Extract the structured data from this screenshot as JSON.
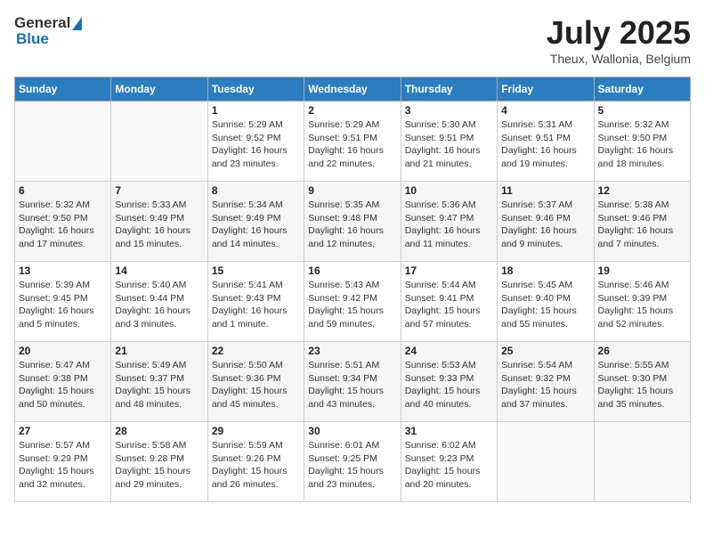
{
  "header": {
    "logo_general": "General",
    "logo_blue": "Blue",
    "month_year": "July 2025",
    "location": "Theux, Wallonia, Belgium"
  },
  "calendar": {
    "days_of_week": [
      "Sunday",
      "Monday",
      "Tuesday",
      "Wednesday",
      "Thursday",
      "Friday",
      "Saturday"
    ],
    "weeks": [
      [
        {
          "day": "",
          "sunrise": "",
          "sunset": "",
          "daylight": ""
        },
        {
          "day": "",
          "sunrise": "",
          "sunset": "",
          "daylight": ""
        },
        {
          "day": "1",
          "sunrise": "Sunrise: 5:29 AM",
          "sunset": "Sunset: 9:52 PM",
          "daylight": "Daylight: 16 hours and 23 minutes."
        },
        {
          "day": "2",
          "sunrise": "Sunrise: 5:29 AM",
          "sunset": "Sunset: 9:51 PM",
          "daylight": "Daylight: 16 hours and 22 minutes."
        },
        {
          "day": "3",
          "sunrise": "Sunrise: 5:30 AM",
          "sunset": "Sunset: 9:51 PM",
          "daylight": "Daylight: 16 hours and 21 minutes."
        },
        {
          "day": "4",
          "sunrise": "Sunrise: 5:31 AM",
          "sunset": "Sunset: 9:51 PM",
          "daylight": "Daylight: 16 hours and 19 minutes."
        },
        {
          "day": "5",
          "sunrise": "Sunrise: 5:32 AM",
          "sunset": "Sunset: 9:50 PM",
          "daylight": "Daylight: 16 hours and 18 minutes."
        }
      ],
      [
        {
          "day": "6",
          "sunrise": "Sunrise: 5:32 AM",
          "sunset": "Sunset: 9:50 PM",
          "daylight": "Daylight: 16 hours and 17 minutes."
        },
        {
          "day": "7",
          "sunrise": "Sunrise: 5:33 AM",
          "sunset": "Sunset: 9:49 PM",
          "daylight": "Daylight: 16 hours and 15 minutes."
        },
        {
          "day": "8",
          "sunrise": "Sunrise: 5:34 AM",
          "sunset": "Sunset: 9:49 PM",
          "daylight": "Daylight: 16 hours and 14 minutes."
        },
        {
          "day": "9",
          "sunrise": "Sunrise: 5:35 AM",
          "sunset": "Sunset: 9:48 PM",
          "daylight": "Daylight: 16 hours and 12 minutes."
        },
        {
          "day": "10",
          "sunrise": "Sunrise: 5:36 AM",
          "sunset": "Sunset: 9:47 PM",
          "daylight": "Daylight: 16 hours and 11 minutes."
        },
        {
          "day": "11",
          "sunrise": "Sunrise: 5:37 AM",
          "sunset": "Sunset: 9:46 PM",
          "daylight": "Daylight: 16 hours and 9 minutes."
        },
        {
          "day": "12",
          "sunrise": "Sunrise: 5:38 AM",
          "sunset": "Sunset: 9:46 PM",
          "daylight": "Daylight: 16 hours and 7 minutes."
        }
      ],
      [
        {
          "day": "13",
          "sunrise": "Sunrise: 5:39 AM",
          "sunset": "Sunset: 9:45 PM",
          "daylight": "Daylight: 16 hours and 5 minutes."
        },
        {
          "day": "14",
          "sunrise": "Sunrise: 5:40 AM",
          "sunset": "Sunset: 9:44 PM",
          "daylight": "Daylight: 16 hours and 3 minutes."
        },
        {
          "day": "15",
          "sunrise": "Sunrise: 5:41 AM",
          "sunset": "Sunset: 9:43 PM",
          "daylight": "Daylight: 16 hours and 1 minute."
        },
        {
          "day": "16",
          "sunrise": "Sunrise: 5:43 AM",
          "sunset": "Sunset: 9:42 PM",
          "daylight": "Daylight: 15 hours and 59 minutes."
        },
        {
          "day": "17",
          "sunrise": "Sunrise: 5:44 AM",
          "sunset": "Sunset: 9:41 PM",
          "daylight": "Daylight: 15 hours and 57 minutes."
        },
        {
          "day": "18",
          "sunrise": "Sunrise: 5:45 AM",
          "sunset": "Sunset: 9:40 PM",
          "daylight": "Daylight: 15 hours and 55 minutes."
        },
        {
          "day": "19",
          "sunrise": "Sunrise: 5:46 AM",
          "sunset": "Sunset: 9:39 PM",
          "daylight": "Daylight: 15 hours and 52 minutes."
        }
      ],
      [
        {
          "day": "20",
          "sunrise": "Sunrise: 5:47 AM",
          "sunset": "Sunset: 9:38 PM",
          "daylight": "Daylight: 15 hours and 50 minutes."
        },
        {
          "day": "21",
          "sunrise": "Sunrise: 5:49 AM",
          "sunset": "Sunset: 9:37 PM",
          "daylight": "Daylight: 15 hours and 48 minutes."
        },
        {
          "day": "22",
          "sunrise": "Sunrise: 5:50 AM",
          "sunset": "Sunset: 9:36 PM",
          "daylight": "Daylight: 15 hours and 45 minutes."
        },
        {
          "day": "23",
          "sunrise": "Sunrise: 5:51 AM",
          "sunset": "Sunset: 9:34 PM",
          "daylight": "Daylight: 15 hours and 43 minutes."
        },
        {
          "day": "24",
          "sunrise": "Sunrise: 5:53 AM",
          "sunset": "Sunset: 9:33 PM",
          "daylight": "Daylight: 15 hours and 40 minutes."
        },
        {
          "day": "25",
          "sunrise": "Sunrise: 5:54 AM",
          "sunset": "Sunset: 9:32 PM",
          "daylight": "Daylight: 15 hours and 37 minutes."
        },
        {
          "day": "26",
          "sunrise": "Sunrise: 5:55 AM",
          "sunset": "Sunset: 9:30 PM",
          "daylight": "Daylight: 15 hours and 35 minutes."
        }
      ],
      [
        {
          "day": "27",
          "sunrise": "Sunrise: 5:57 AM",
          "sunset": "Sunset: 9:29 PM",
          "daylight": "Daylight: 15 hours and 32 minutes."
        },
        {
          "day": "28",
          "sunrise": "Sunrise: 5:58 AM",
          "sunset": "Sunset: 9:28 PM",
          "daylight": "Daylight: 15 hours and 29 minutes."
        },
        {
          "day": "29",
          "sunrise": "Sunrise: 5:59 AM",
          "sunset": "Sunset: 9:26 PM",
          "daylight": "Daylight: 15 hours and 26 minutes."
        },
        {
          "day": "30",
          "sunrise": "Sunrise: 6:01 AM",
          "sunset": "Sunset: 9:25 PM",
          "daylight": "Daylight: 15 hours and 23 minutes."
        },
        {
          "day": "31",
          "sunrise": "Sunrise: 6:02 AM",
          "sunset": "Sunset: 9:23 PM",
          "daylight": "Daylight: 15 hours and 20 minutes."
        },
        {
          "day": "",
          "sunrise": "",
          "sunset": "",
          "daylight": ""
        },
        {
          "day": "",
          "sunrise": "",
          "sunset": "",
          "daylight": ""
        }
      ]
    ]
  }
}
